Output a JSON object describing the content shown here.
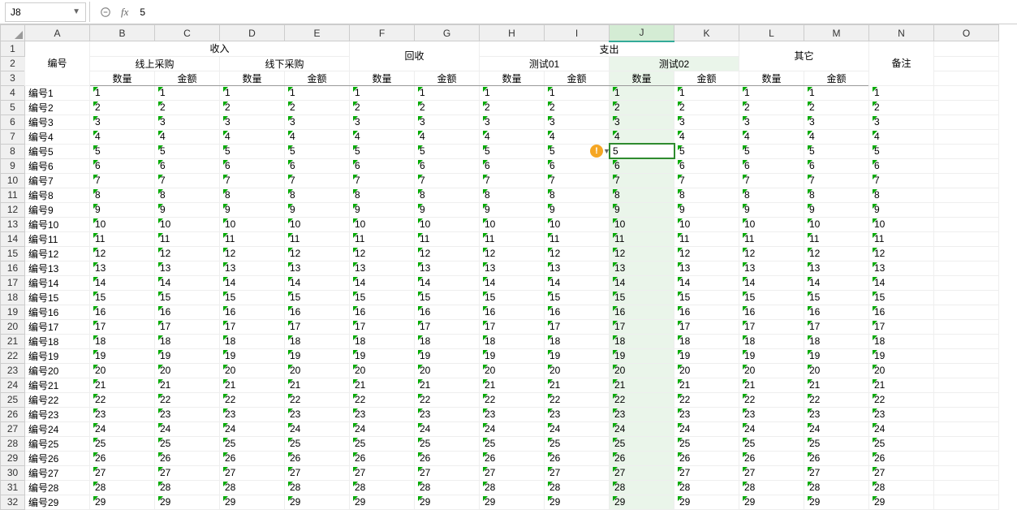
{
  "formula_bar": {
    "name_box": "J8",
    "fx": "fx",
    "formula": "5"
  },
  "columns": [
    "A",
    "B",
    "C",
    "D",
    "E",
    "F",
    "G",
    "H",
    "I",
    "J",
    "K",
    "L",
    "M",
    "N",
    "O"
  ],
  "row_numbers": [
    1,
    2,
    3,
    4,
    5,
    6,
    7,
    8,
    9,
    10,
    11,
    12,
    13,
    14,
    15,
    16,
    17,
    18,
    19,
    20,
    21,
    22,
    23,
    24,
    25,
    26,
    27,
    28,
    29,
    30,
    31,
    32
  ],
  "header1": {
    "A": "编号",
    "BE": "收入",
    "FG": "回收",
    "HK": "支出",
    "LM": "其它",
    "N": "备注"
  },
  "header2": {
    "BC": "线上采购",
    "DE": "线下采购",
    "HI": "测试01",
    "JK": "测试02"
  },
  "header3": {
    "B": "数量",
    "C": "金额",
    "D": "数量",
    "E": "金额",
    "F": "数量",
    "G": "金额",
    "H": "数量",
    "I": "金额",
    "J": "数量",
    "K": "金额",
    "L": "数量",
    "M": "金额"
  },
  "rows": [
    {
      "id": "编号1",
      "v": "1"
    },
    {
      "id": "编号2",
      "v": "2"
    },
    {
      "id": "编号3",
      "v": "3"
    },
    {
      "id": "编号4",
      "v": "4"
    },
    {
      "id": "编号5",
      "v": "5"
    },
    {
      "id": "编号6",
      "v": "6"
    },
    {
      "id": "编号7",
      "v": "7"
    },
    {
      "id": "编号8",
      "v": "8"
    },
    {
      "id": "编号9",
      "v": "9"
    },
    {
      "id": "编号10",
      "v": "10"
    },
    {
      "id": "编号11",
      "v": "11"
    },
    {
      "id": "编号12",
      "v": "12"
    },
    {
      "id": "编号13",
      "v": "13"
    },
    {
      "id": "编号14",
      "v": "14"
    },
    {
      "id": "编号15",
      "v": "15"
    },
    {
      "id": "编号16",
      "v": "16"
    },
    {
      "id": "编号17",
      "v": "17"
    },
    {
      "id": "编号18",
      "v": "18"
    },
    {
      "id": "编号19",
      "v": "19"
    },
    {
      "id": "编号20",
      "v": "20"
    },
    {
      "id": "编号21",
      "v": "21"
    },
    {
      "id": "编号22",
      "v": "22"
    },
    {
      "id": "编号23",
      "v": "23"
    },
    {
      "id": "编号24",
      "v": "24"
    },
    {
      "id": "编号25",
      "v": "25"
    },
    {
      "id": "编号26",
      "v": "26"
    },
    {
      "id": "编号27",
      "v": "27"
    },
    {
      "id": "编号28",
      "v": "28"
    },
    {
      "id": "编号29",
      "v": "29"
    }
  ],
  "active_cell": {
    "row_idx": 4,
    "col": "J"
  },
  "warning_icon": "!"
}
